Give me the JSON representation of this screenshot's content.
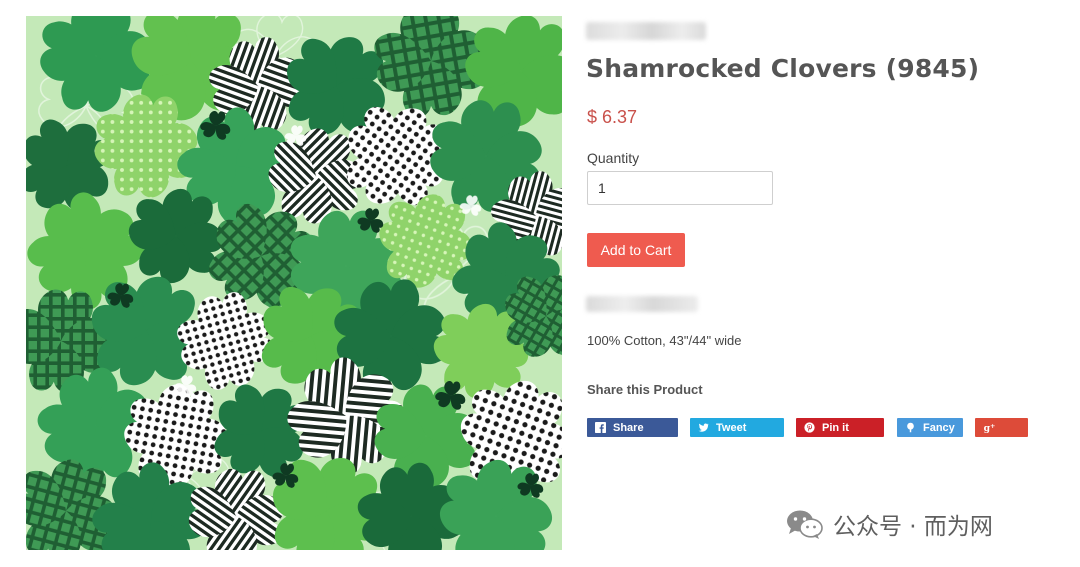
{
  "product": {
    "title": "Shamrocked Clovers (9845)",
    "price": "$ 6.37",
    "image_alt": "Shamrocked Clovers fabric",
    "description": "100% Cotton, 43\"/44\" wide"
  },
  "quantity": {
    "label": "Quantity",
    "value": "1"
  },
  "cart": {
    "add_label": "Add to Cart"
  },
  "share": {
    "heading": "Share this Product",
    "buttons": [
      {
        "label": "Share",
        "icon": "facebook-icon",
        "color": "#3b5998"
      },
      {
        "label": "Tweet",
        "icon": "twitter-icon",
        "color": "#22a9e0"
      },
      {
        "label": "Pin it",
        "icon": "pinterest-icon",
        "color": "#cb2027"
      },
      {
        "label": "Fancy",
        "icon": "fancy-icon",
        "color": "#4999dc"
      },
      {
        "label": "",
        "icon": "google-plus-icon",
        "color": "#dd4b39"
      }
    ]
  },
  "watermark": {
    "text": "公众号 · 而为网"
  },
  "colors": {
    "accent_price": "#c9514b",
    "cart_button": "#ef5b4f",
    "fabric_background": "#bfe6b4"
  }
}
